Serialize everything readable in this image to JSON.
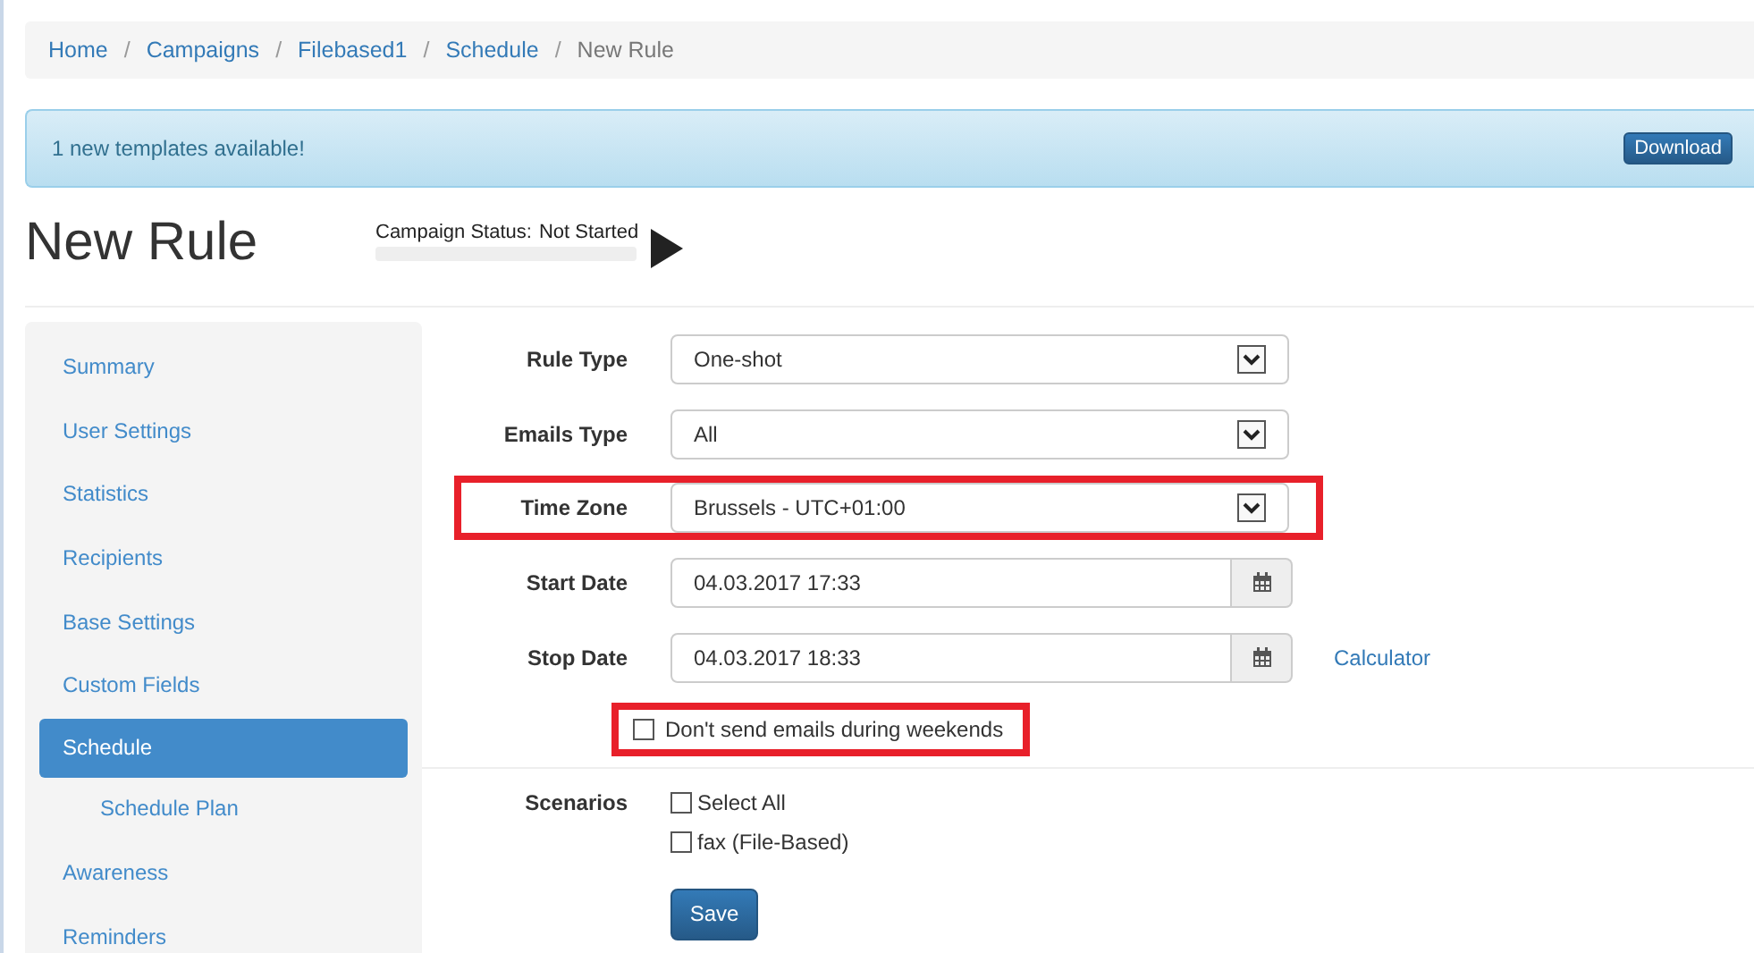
{
  "breadcrumb": [
    {
      "label": "Home",
      "current": false
    },
    {
      "separator": "/",
      "label": "Campaigns",
      "current": false
    },
    {
      "separator": "/",
      "label": "Filebased1",
      "current": false
    },
    {
      "separator": "/",
      "label": "Schedule",
      "current": false
    },
    {
      "separator": "/",
      "label": "New Rule",
      "current": true
    }
  ],
  "alert": {
    "message": "1 new templates available!",
    "button": "Download"
  },
  "page_title": "New Rule",
  "campaign_status": {
    "label": "Campaign Status:",
    "value": "Not Started",
    "level": 0
  },
  "sidebar": {
    "items": [
      {
        "label": "Summary",
        "selected": false
      },
      {
        "label": "User Settings",
        "selected": false
      },
      {
        "label": "Statistics",
        "selected": false
      },
      {
        "label": "Recipients",
        "selected": false
      },
      {
        "label": "Base Settings",
        "selected": false
      },
      {
        "label": "Custom Fields",
        "selected": false
      },
      {
        "label": "Schedule",
        "selected": true,
        "children": [
          {
            "label": "Schedule Plan",
            "selected": false
          }
        ]
      },
      {
        "label": "Awareness",
        "selected": false
      },
      {
        "label": "Reminders",
        "selected": false
      }
    ]
  },
  "form": {
    "fields": [
      {
        "kind": "select",
        "label": "Rule Type",
        "value": "One-shot",
        "highlighted": false
      },
      {
        "kind": "select",
        "label": "Emails Type",
        "value": "All",
        "highlighted": false
      },
      {
        "kind": "select",
        "label": "Time Zone",
        "value": "Brussels - UTC+01:00",
        "highlighted": true
      },
      {
        "kind": "date",
        "label": "Start Date",
        "value": "04.03.2017 17:33",
        "highlighted": false
      },
      {
        "kind": "date",
        "label": "Stop Date",
        "value": "04.03.2017 18:33",
        "highlighted": false,
        "link": "Calculator"
      }
    ],
    "weekend_option": {
      "label": "Don't send emails during weekends",
      "checked": false,
      "highlighted": true
    },
    "scenarios": {
      "label": "Scenarios",
      "options": [
        {
          "label": "Select All",
          "checked": false
        },
        {
          "label": "fax (File-Based)",
          "checked": false
        }
      ]
    },
    "save_button": "Save"
  }
}
